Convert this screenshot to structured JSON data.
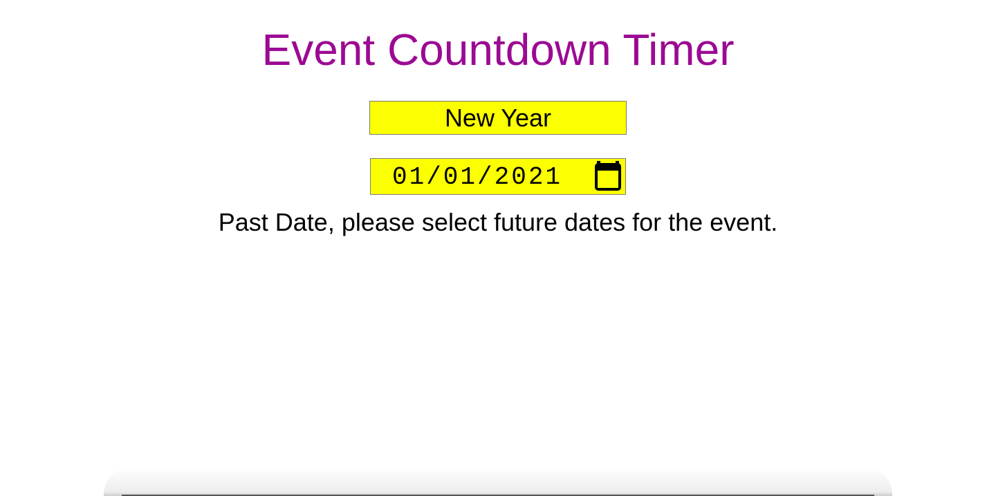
{
  "title": "Event Countdown Timer",
  "event_name": {
    "value": "New Year"
  },
  "event_date": {
    "value": "01/01/2021",
    "icon": "calendar-icon"
  },
  "message": "Past Date, please select future dates for the event.",
  "colors": {
    "title": "#9b0a93",
    "field_background": "#fbff00",
    "text": "#000000"
  }
}
